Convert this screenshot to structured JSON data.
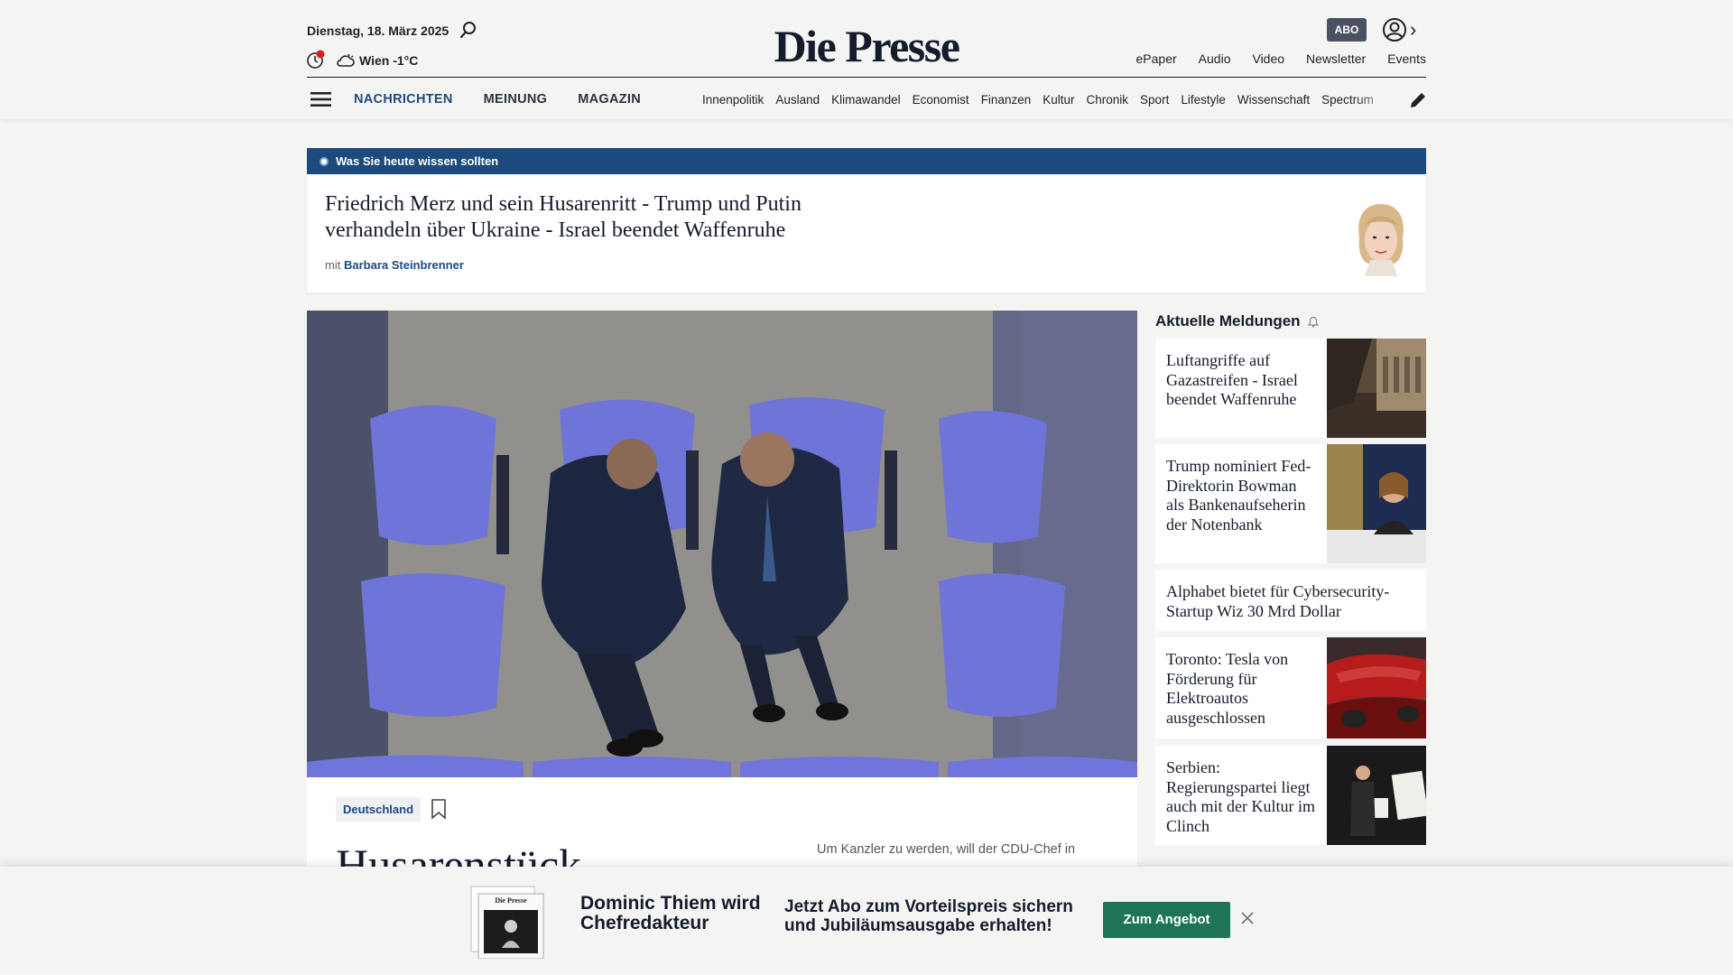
{
  "header": {
    "date": "Dienstag, 18. März 2025",
    "weather": "Wien -1°C",
    "logo": "Die Presse",
    "abo_label": "ABO",
    "top_links": [
      "ePaper",
      "Audio",
      "Video",
      "Newsletter",
      "Events"
    ],
    "main_nav": [
      "NACHRICHTEN",
      "MEINUNG",
      "MAGAZIN"
    ],
    "sub_nav": [
      "Innenpolitik",
      "Ausland",
      "Klimawandel",
      "Economist",
      "Finanzen",
      "Kultur",
      "Chronik",
      "Sport",
      "Lifestyle",
      "Wissenschaft",
      "Spectrum"
    ]
  },
  "briefing": {
    "bar_label": "Was Sie heute wissen sollten",
    "title": "Friedrich Merz und sein Husarenritt - Trump und Putin verhandeln über Ukraine - Israel beendet Waffenruhe",
    "meta_prefix": "mit",
    "author": "Barbara Steinbrenner"
  },
  "article": {
    "tag": "Deutschland",
    "headline": "Husarenstück",
    "teaser": "Um Kanzler zu werden, will der CDU-Chef in"
  },
  "sidebar": {
    "title": "Aktuelle Meldungen",
    "items": [
      {
        "text": "Luftangriffe auf Gazastreifen - Israel beendet Waffenruhe"
      },
      {
        "text": "Trump nominiert Fed-Direktorin Bowman als Bankenaufseherin der Notenbank"
      },
      {
        "text": "Alphabet bietet für Cybersecurity-Startup Wiz 30 Mrd Dollar"
      },
      {
        "text": "Toronto: Tesla von Förderung für Elektroautos ausgeschlossen"
      },
      {
        "text": "Serbien: Regierungspartei liegt auch mit der Kultur im Clinch"
      }
    ]
  },
  "promo": {
    "name": "Dominic Thiem wird Chefredakteur",
    "offer": "Jetzt Abo zum Vorteilspreis sichern und Jubiläumsausgabe erhalten!",
    "button": "Zum Angebot",
    "paper_logo": "Die Presse"
  },
  "colors": {
    "brand_blue": "#1d4a7c",
    "cta_green": "#1e7456",
    "background": "#f4f4f2"
  }
}
